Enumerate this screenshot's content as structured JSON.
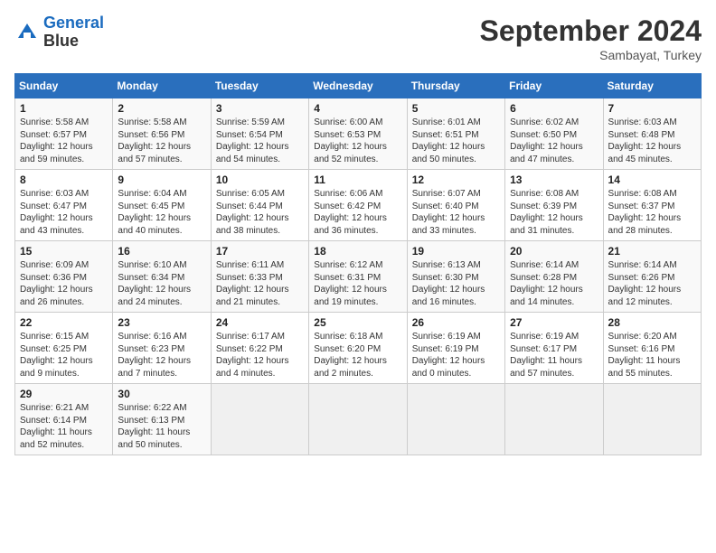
{
  "header": {
    "logo_line1": "General",
    "logo_line2": "Blue",
    "month_year": "September 2024",
    "location": "Sambayat, Turkey"
  },
  "days_of_week": [
    "Sunday",
    "Monday",
    "Tuesday",
    "Wednesday",
    "Thursday",
    "Friday",
    "Saturday"
  ],
  "weeks": [
    [
      {
        "day": "1",
        "info": "Sunrise: 5:58 AM\nSunset: 6:57 PM\nDaylight: 12 hours\nand 59 minutes."
      },
      {
        "day": "2",
        "info": "Sunrise: 5:58 AM\nSunset: 6:56 PM\nDaylight: 12 hours\nand 57 minutes."
      },
      {
        "day": "3",
        "info": "Sunrise: 5:59 AM\nSunset: 6:54 PM\nDaylight: 12 hours\nand 54 minutes."
      },
      {
        "day": "4",
        "info": "Sunrise: 6:00 AM\nSunset: 6:53 PM\nDaylight: 12 hours\nand 52 minutes."
      },
      {
        "day": "5",
        "info": "Sunrise: 6:01 AM\nSunset: 6:51 PM\nDaylight: 12 hours\nand 50 minutes."
      },
      {
        "day": "6",
        "info": "Sunrise: 6:02 AM\nSunset: 6:50 PM\nDaylight: 12 hours\nand 47 minutes."
      },
      {
        "day": "7",
        "info": "Sunrise: 6:03 AM\nSunset: 6:48 PM\nDaylight: 12 hours\nand 45 minutes."
      }
    ],
    [
      {
        "day": "8",
        "info": "Sunrise: 6:03 AM\nSunset: 6:47 PM\nDaylight: 12 hours\nand 43 minutes."
      },
      {
        "day": "9",
        "info": "Sunrise: 6:04 AM\nSunset: 6:45 PM\nDaylight: 12 hours\nand 40 minutes."
      },
      {
        "day": "10",
        "info": "Sunrise: 6:05 AM\nSunset: 6:44 PM\nDaylight: 12 hours\nand 38 minutes."
      },
      {
        "day": "11",
        "info": "Sunrise: 6:06 AM\nSunset: 6:42 PM\nDaylight: 12 hours\nand 36 minutes."
      },
      {
        "day": "12",
        "info": "Sunrise: 6:07 AM\nSunset: 6:40 PM\nDaylight: 12 hours\nand 33 minutes."
      },
      {
        "day": "13",
        "info": "Sunrise: 6:08 AM\nSunset: 6:39 PM\nDaylight: 12 hours\nand 31 minutes."
      },
      {
        "day": "14",
        "info": "Sunrise: 6:08 AM\nSunset: 6:37 PM\nDaylight: 12 hours\nand 28 minutes."
      }
    ],
    [
      {
        "day": "15",
        "info": "Sunrise: 6:09 AM\nSunset: 6:36 PM\nDaylight: 12 hours\nand 26 minutes."
      },
      {
        "day": "16",
        "info": "Sunrise: 6:10 AM\nSunset: 6:34 PM\nDaylight: 12 hours\nand 24 minutes."
      },
      {
        "day": "17",
        "info": "Sunrise: 6:11 AM\nSunset: 6:33 PM\nDaylight: 12 hours\nand 21 minutes."
      },
      {
        "day": "18",
        "info": "Sunrise: 6:12 AM\nSunset: 6:31 PM\nDaylight: 12 hours\nand 19 minutes."
      },
      {
        "day": "19",
        "info": "Sunrise: 6:13 AM\nSunset: 6:30 PM\nDaylight: 12 hours\nand 16 minutes."
      },
      {
        "day": "20",
        "info": "Sunrise: 6:14 AM\nSunset: 6:28 PM\nDaylight: 12 hours\nand 14 minutes."
      },
      {
        "day": "21",
        "info": "Sunrise: 6:14 AM\nSunset: 6:26 PM\nDaylight: 12 hours\nand 12 minutes."
      }
    ],
    [
      {
        "day": "22",
        "info": "Sunrise: 6:15 AM\nSunset: 6:25 PM\nDaylight: 12 hours\nand 9 minutes."
      },
      {
        "day": "23",
        "info": "Sunrise: 6:16 AM\nSunset: 6:23 PM\nDaylight: 12 hours\nand 7 minutes."
      },
      {
        "day": "24",
        "info": "Sunrise: 6:17 AM\nSunset: 6:22 PM\nDaylight: 12 hours\nand 4 minutes."
      },
      {
        "day": "25",
        "info": "Sunrise: 6:18 AM\nSunset: 6:20 PM\nDaylight: 12 hours\nand 2 minutes."
      },
      {
        "day": "26",
        "info": "Sunrise: 6:19 AM\nSunset: 6:19 PM\nDaylight: 12 hours\nand 0 minutes."
      },
      {
        "day": "27",
        "info": "Sunrise: 6:19 AM\nSunset: 6:17 PM\nDaylight: 11 hours\nand 57 minutes."
      },
      {
        "day": "28",
        "info": "Sunrise: 6:20 AM\nSunset: 6:16 PM\nDaylight: 11 hours\nand 55 minutes."
      }
    ],
    [
      {
        "day": "29",
        "info": "Sunrise: 6:21 AM\nSunset: 6:14 PM\nDaylight: 11 hours\nand 52 minutes."
      },
      {
        "day": "30",
        "info": "Sunrise: 6:22 AM\nSunset: 6:13 PM\nDaylight: 11 hours\nand 50 minutes."
      },
      {
        "day": "",
        "info": ""
      },
      {
        "day": "",
        "info": ""
      },
      {
        "day": "",
        "info": ""
      },
      {
        "day": "",
        "info": ""
      },
      {
        "day": "",
        "info": ""
      }
    ]
  ]
}
